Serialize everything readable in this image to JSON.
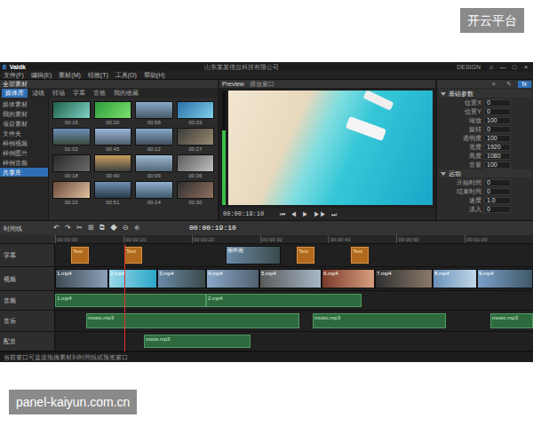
{
  "watermark": {
    "text": "开云平台"
  },
  "caption": {
    "text": "panel-kaiyun.com.cn"
  },
  "titlebar": {
    "logo_mark": "E",
    "logo": "Valdk",
    "title": "山东某某信息科技有限公司",
    "user": "DESIGN",
    "controls": [
      "⌂",
      "—",
      "□",
      "×"
    ]
  },
  "menu": [
    "文件(F)",
    "编辑(E)",
    "素材(M)",
    "特效(T)",
    "工具(O)",
    "帮助(H)"
  ],
  "library": {
    "title": "全部素材",
    "tabs": [
      {
        "label": "媒体库",
        "selected": true
      },
      {
        "label": "滤镜",
        "selected": false
      },
      {
        "label": "转场",
        "selected": false
      },
      {
        "label": "字幕",
        "selected": false
      },
      {
        "label": "音效",
        "selected": false
      },
      {
        "label": "我的收藏",
        "selected": false
      }
    ],
    "folders": [
      {
        "label": "媒体素材",
        "selected": false
      },
      {
        "label": "我的素材",
        "selected": false
      },
      {
        "label": "项目素材",
        "selected": false
      },
      {
        "label": "文件夹",
        "selected": false
      },
      {
        "label": "样例视频",
        "selected": false
      },
      {
        "label": "样例图片",
        "selected": false
      },
      {
        "label": "样例音频",
        "selected": false
      },
      {
        "label": "共享库",
        "selected": true
      }
    ],
    "items": [
      "00:15",
      "00:20",
      "00:58",
      "00:33",
      "01:02",
      "00:45",
      "00:12",
      "00:27",
      "00:18",
      "00:40",
      "00:09",
      "00:36",
      "00:22",
      "00:51",
      "00:14",
      "00:30"
    ]
  },
  "preview": {
    "tab": "Preview",
    "title": "播放窗口",
    "timecode": "00:00:19:10",
    "controls": [
      "⏮",
      "◀",
      "▶",
      "▶▶",
      "⏭"
    ],
    "meter_level": 0.65
  },
  "props": {
    "tabs": [
      {
        "label": "≡",
        "selected": false
      },
      {
        "label": "✎",
        "selected": false
      },
      {
        "label": "fx",
        "selected": true
      }
    ],
    "sections": [
      {
        "title": "基础参数",
        "expanded": true,
        "rows": [
          {
            "label": "位置X",
            "value": "0"
          },
          {
            "label": "位置Y",
            "value": "0"
          },
          {
            "label": "缩放",
            "value": "100"
          },
          {
            "label": "旋转",
            "value": "0"
          },
          {
            "label": "透明度",
            "value": "100"
          },
          {
            "label": "宽度",
            "value": "1920"
          },
          {
            "label": "高度",
            "value": "1080"
          },
          {
            "label": "音量",
            "value": "100"
          }
        ]
      },
      {
        "title": "运动",
        "expanded": true,
        "rows": [
          {
            "label": "开始时间",
            "value": "0"
          },
          {
            "label": "结束时间",
            "value": "0"
          },
          {
            "label": "速度",
            "value": "1.0"
          },
          {
            "label": "淡入",
            "value": "0"
          }
        ]
      }
    ]
  },
  "toolbar": {
    "label": "时间线",
    "timecode": "00:00:19:10",
    "tools": [
      "↶",
      "↷",
      "✂",
      "⊞",
      "⧉",
      "◆",
      "⊖",
      "⊕"
    ]
  },
  "ruler": [
    "00:00:00",
    "00:00:10",
    "00:00:20",
    "00:00:30",
    "00:00:40",
    "00:00:50",
    "00:01:00"
  ],
  "tracks": [
    {
      "name": "字幕",
      "clips": [
        {
          "label": "Text",
          "kind": "title"
        },
        {
          "label": "Text",
          "kind": "title"
        },
        {
          "label": "画中画",
          "kind": "video"
        },
        {
          "label": "Text",
          "kind": "title"
        },
        {
          "label": "Text",
          "kind": "title"
        }
      ]
    },
    {
      "name": "视频",
      "clips": [
        {
          "label": "1.mp4",
          "kind": "video"
        },
        {
          "label": "2.mp4",
          "kind": "video"
        },
        {
          "label": "3.mp4",
          "kind": "video"
        },
        {
          "label": "4.mp4",
          "kind": "video"
        },
        {
          "label": "5.mp4",
          "kind": "video"
        },
        {
          "label": "6.mp4",
          "kind": "video"
        },
        {
          "label": "7.mp4",
          "kind": "video"
        },
        {
          "label": "8.mp4",
          "kind": "video"
        },
        {
          "label": "9.mp4",
          "kind": "video"
        }
      ]
    },
    {
      "name": "音频",
      "clips": [
        {
          "label": "1.mp4",
          "kind": "audio"
        },
        {
          "label": "2.mp4",
          "kind": "audio"
        }
      ]
    },
    {
      "name": "音乐",
      "clips": [
        {
          "label": "music.mp3",
          "kind": "audio"
        },
        {
          "label": "music.mp3",
          "kind": "audio"
        },
        {
          "label": "music.mp3",
          "kind": "audio"
        }
      ]
    },
    {
      "name": "配音",
      "clips": [
        {
          "label": "voice.mp3",
          "kind": "audio"
        }
      ]
    }
  ],
  "status": {
    "text": "当前窗口可直接拖拽素材到时间线或预览窗口"
  }
}
